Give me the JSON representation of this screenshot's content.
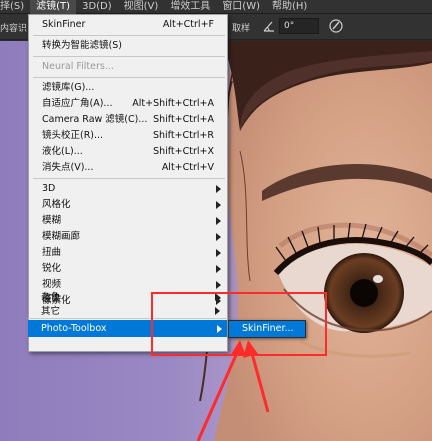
{
  "menubar": {
    "items": [
      "择(S)",
      "滤镜(T)",
      "3D(D)",
      "视图(V)",
      "增效工具",
      "窗口(W)",
      "帮助(H)"
    ],
    "active_index": 1
  },
  "optbar": {
    "left_text": "内容识",
    "sample_label": "取样",
    "angle_value": "0°"
  },
  "filter_menu": {
    "items": [
      {
        "label": "SkinFiner",
        "shortcut": "Alt+Ctrl+F"
      },
      {
        "label": "转换为智能滤镜(S)",
        "shortcut": ""
      },
      {
        "label": "Neural Filters...",
        "shortcut": "",
        "disabled": true
      },
      {
        "label": "滤镜库(G)...",
        "shortcut": ""
      },
      {
        "label": "自适应广角(A)...",
        "shortcut": "Alt+Shift+Ctrl+A"
      },
      {
        "label": "Camera Raw 滤镜(C)...",
        "shortcut": "Shift+Ctrl+A"
      },
      {
        "label": "镜头校正(R)...",
        "shortcut": "Shift+Ctrl+R"
      },
      {
        "label": "液化(L)...",
        "shortcut": "Shift+Ctrl+X"
      },
      {
        "label": "消失点(V)...",
        "shortcut": "Alt+Ctrl+V"
      },
      {
        "label": "3D",
        "submenu": true
      },
      {
        "label": "风格化",
        "submenu": true
      },
      {
        "label": "模糊",
        "submenu": true
      },
      {
        "label": "模糊画廊",
        "submenu": true
      },
      {
        "label": "扭曲",
        "submenu": true
      },
      {
        "label": "锐化",
        "submenu": true
      },
      {
        "label": "视频",
        "submenu": true
      },
      {
        "label": "像素化",
        "submenu": true
      },
      {
        "label": "渲染",
        "submenu": true
      },
      {
        "label": "杂色",
        "submenu": true
      },
      {
        "label": "其它",
        "submenu": true
      },
      {
        "label": "Photo-Toolbox",
        "submenu": true,
        "selected": true
      }
    ]
  },
  "submenu": {
    "items": [
      "SkinFiner..."
    ]
  },
  "colors": {
    "menu_highlight": "#0078d7",
    "annotation_red": "#ff2a2a"
  }
}
